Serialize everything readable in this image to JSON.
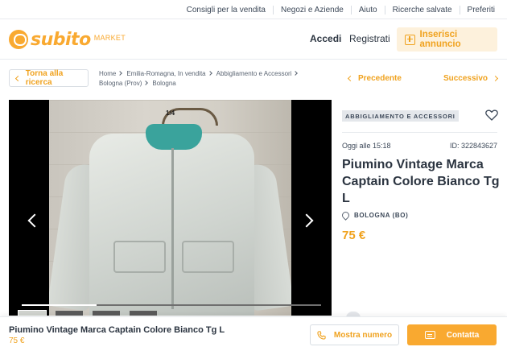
{
  "utility_links": [
    "Consigli per la vendita",
    "Negozi e Aziende",
    "Aiuto",
    "Ricerche salvate",
    "Preferiti"
  ],
  "header": {
    "logo_word": "subito",
    "logo_market": "MARKET",
    "login_label": "Accedi",
    "register_label": "Registrati",
    "post_ad_label": "Inserisci annuncio"
  },
  "nav": {
    "back_label": "Torna alla ricerca",
    "prev_label": "Precedente",
    "next_label": "Successivo"
  },
  "breadcrumb": [
    "Home",
    "Emilia-Romagna, In vendita",
    "Abbigliamento e Accessori",
    "Bologna (Prov)",
    "Bologna"
  ],
  "gallery": {
    "counter": "1/4",
    "current_index": 1,
    "total": 4,
    "progress_fraction": 0.25
  },
  "listing": {
    "category": "ABBIGLIAMENTO E ACCESSORI",
    "date": "Oggi alle 15:18",
    "ad_id": "ID: 322843627",
    "title": "Piumino Vintage Marca Captain Colore Bianco Tg L",
    "location": "BOLOGNA (BO)",
    "price": "75 €"
  },
  "sticky_bar": {
    "title": "Piumino Vintage Marca Captain Colore Bianco Tg L",
    "price": "75 €",
    "phone_button": "Mostra numero",
    "contact_button": "Contatta"
  },
  "colors": {
    "accent": "#f9a930",
    "accent_text": "#f0a21e",
    "text": "#3c4858",
    "border": "#d8dde3"
  },
  "icons": [
    "logo-icon",
    "plus-icon",
    "chevron-left-icon",
    "chevron-right-icon",
    "heart-icon",
    "location-pin-icon",
    "phone-icon",
    "chat-icon"
  ]
}
